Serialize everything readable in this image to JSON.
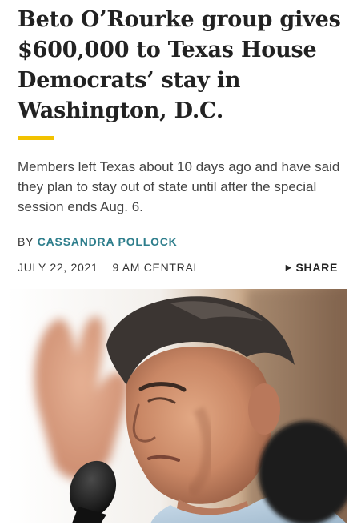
{
  "article": {
    "headline": "Beto O’Rourke group gives $600,000 to Texas House Democrats’ stay in Washington, D.C.",
    "dek": "Members left Texas about 10 days ago and have said they plan to stay out of state until after the special session ends Aug. 6.",
    "byline_prefix": "BY",
    "author": "CASSANDRA POLLOCK",
    "date": "JULY 22, 2021",
    "time": "9 AM CENTRAL",
    "share_label": "SHARE",
    "share_icon": "triangle-right-icon"
  },
  "colors": {
    "accent_bar": "#f2c200",
    "author_link": "#2e7e8c",
    "headline": "#222222"
  },
  "photo": {
    "alt": ""
  }
}
